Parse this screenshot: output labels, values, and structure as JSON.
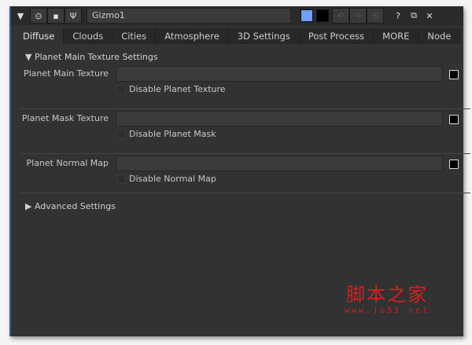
{
  "titlebar": {
    "node_name": "Gizmo1",
    "help": "?",
    "float": "⧉",
    "close": "✕"
  },
  "tabs": [
    "Diffuse",
    "Clouds",
    "Cities",
    "Atmosphere",
    "3D Settings",
    "Post Process",
    "MORE",
    "Node"
  ],
  "section_main": "Planet Main Texture Settings",
  "rows": [
    {
      "label": "Planet Main Texture",
      "value": "",
      "checkbox": "Disable Planet Texture",
      "checked": false
    },
    {
      "label": "Planet Mask Texture",
      "value": "",
      "checkbox": "Disable Planet Mask",
      "checked": false
    },
    {
      "label": "Planet Normal Map",
      "value": "",
      "checkbox": "Disable Normal Map",
      "checked": false
    }
  ],
  "section_advanced": "Advanced Settings",
  "colors": {
    "accent": "#6f9fff",
    "bg": "#323232"
  },
  "watermark": {
    "title": "脚本之家",
    "url": "www.jb51.net"
  }
}
